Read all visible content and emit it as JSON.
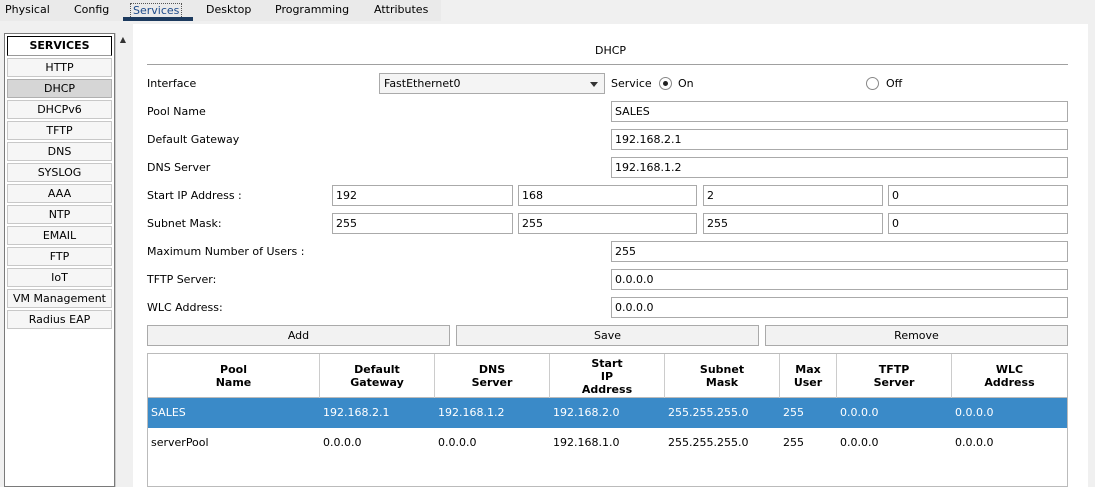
{
  "tabs": [
    "Physical",
    "Config",
    "Services",
    "Desktop",
    "Programming",
    "Attributes"
  ],
  "active_tab": "Services",
  "services": {
    "header": "SERVICES",
    "items": [
      "HTTP",
      "DHCP",
      "DHCPv6",
      "TFTP",
      "DNS",
      "SYSLOG",
      "AAA",
      "NTP",
      "EMAIL",
      "FTP",
      "IoT",
      "VM Management",
      "Radius EAP"
    ],
    "selected": "DHCP"
  },
  "dhcp": {
    "title": "DHCP",
    "interface_label": "Interface",
    "interface_value": "FastEthernet0",
    "service_label": "Service",
    "on_label": "On",
    "off_label": "Off",
    "service_state": "On",
    "pool_name_label": "Pool Name",
    "pool_name_value": "SALES",
    "gateway_label": "Default Gateway",
    "gateway_value": "192.168.2.1",
    "dns_label": "DNS Server",
    "dns_value": "192.168.1.2",
    "start_ip_label": "Start IP Address :",
    "start_ip": [
      "192",
      "168",
      "2",
      "0"
    ],
    "subnet_label": "Subnet Mask:",
    "subnet": [
      "255",
      "255",
      "255",
      "0"
    ],
    "max_users_label": "Maximum Number of Users :",
    "max_users_value": "255",
    "tftp_label": "TFTP Server:",
    "tftp_value": "0.0.0.0",
    "wlc_label": "WLC Address:",
    "wlc_value": "0.0.0.0",
    "add_label": "Add",
    "save_label": "Save",
    "remove_label": "Remove"
  },
  "table": {
    "columns": [
      "Pool\nName",
      "Default\nGateway",
      "DNS\nServer",
      "Start\nIP\nAddress",
      "Subnet\nMask",
      "Max\nUser",
      "TFTP\nServer",
      "WLC\nAddress"
    ],
    "rows": [
      [
        "SALES",
        "192.168.2.1",
        "192.168.1.2",
        "192.168.2.0",
        "255.255.255.0",
        "255",
        "0.0.0.0",
        "0.0.0.0"
      ],
      [
        "serverPool",
        "0.0.0.0",
        "0.0.0.0",
        "192.168.1.0",
        "255.255.255.0",
        "255",
        "0.0.0.0",
        "0.0.0.0"
      ]
    ],
    "selected_row": 0
  },
  "colors": {
    "selection": "#3a8ac8",
    "tab_underline": "#1c3a5e"
  }
}
